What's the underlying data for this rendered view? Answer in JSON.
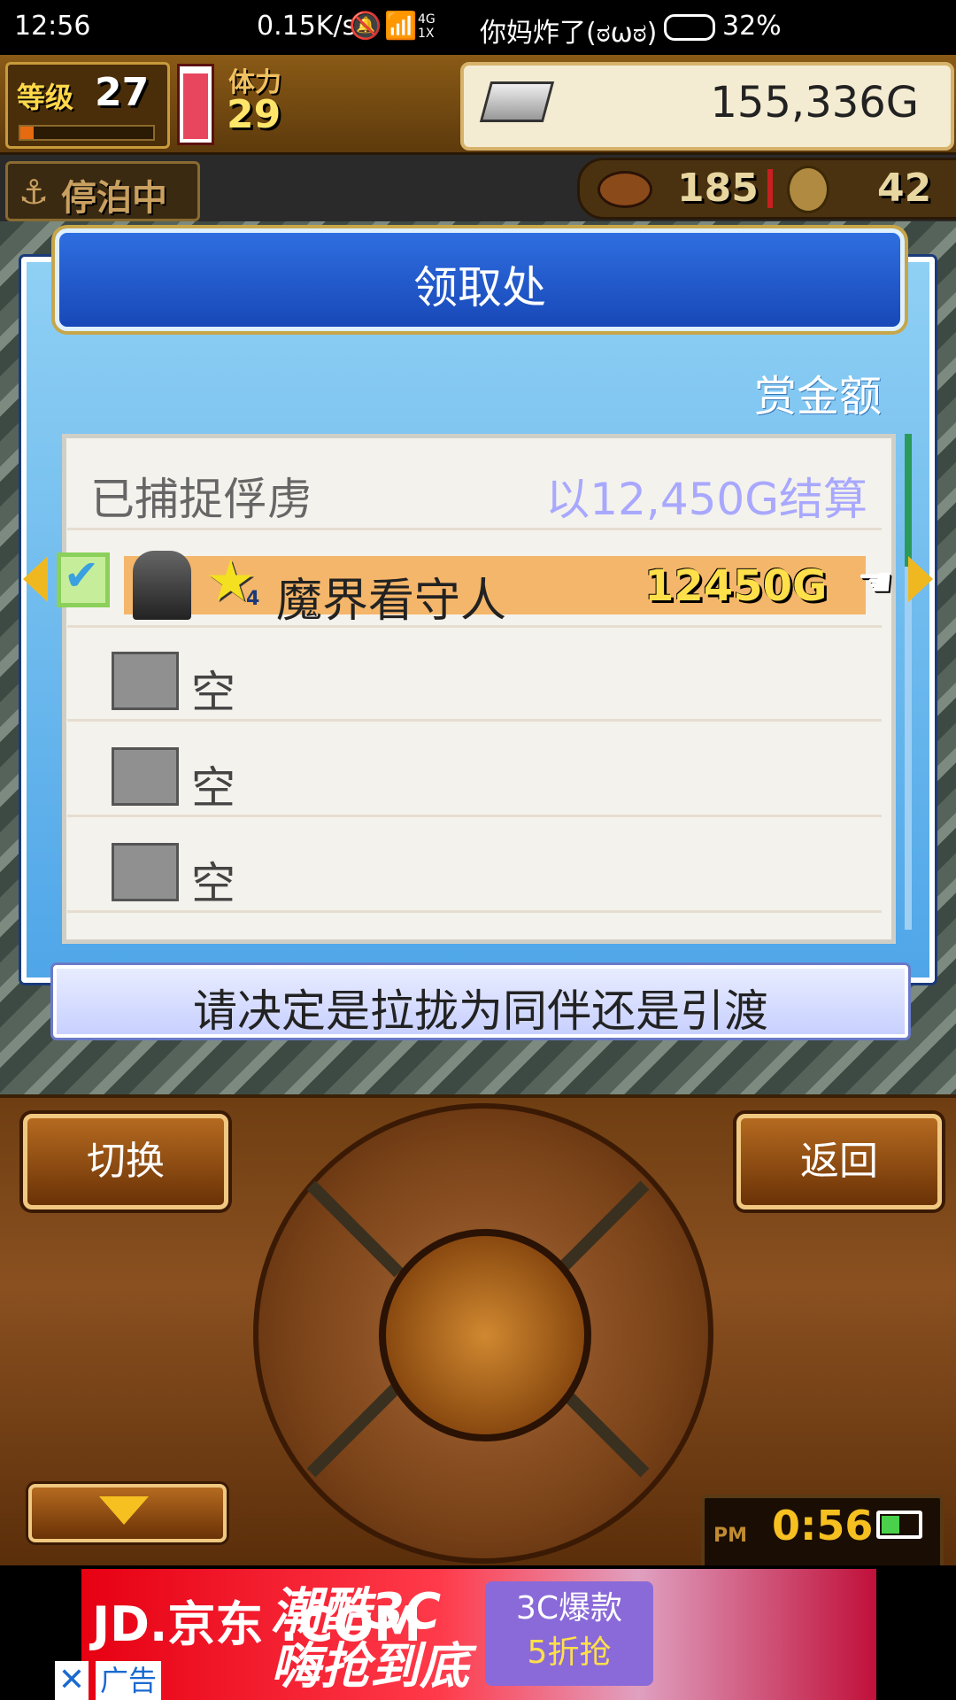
{
  "status_bar": {
    "time": "12:56",
    "network_speed": "0.15K/s",
    "network_type": "4G 1X",
    "carrier": "你妈炸了(ಠωಠ)",
    "battery": "32%"
  },
  "hud": {
    "level_label": "等级",
    "level_value": "27",
    "level_progress": 0.1,
    "stamina_label": "体力",
    "stamina_value": "29",
    "stamina_fill": 0.95,
    "gold_value": "155,336G",
    "docked_status": "停泊中",
    "food_value": "185",
    "coin_value": "42"
  },
  "dialog": {
    "title": "领取处",
    "bounty_header": "赏金额",
    "captured_label": "已捕捉俘虏",
    "settle_text": "以12,450G结算",
    "selected_prisoner": {
      "name": "魔界看守人",
      "rank": "4",
      "bounty": "12450G",
      "checked": true
    },
    "empty_slots": [
      "空",
      "空",
      "空"
    ],
    "message": "请决定是拉拢为同伴还是引渡"
  },
  "controls": {
    "switch_label": "切换",
    "back_label": "返回",
    "clock_ampm": "PM",
    "clock_time": "0:56"
  },
  "ad": {
    "brand": "JD.京东 .COM",
    "slogan": "潮酷3C 嗨抢到底",
    "promo_title": "3C爆款",
    "promo_sub": "5折抢",
    "tag": "广告",
    "close": "✕"
  },
  "colors": {
    "dialog_blue": "#2f6ee0",
    "selected_row": "#f4b66a",
    "bounty_yellow": "#ffe04a"
  }
}
